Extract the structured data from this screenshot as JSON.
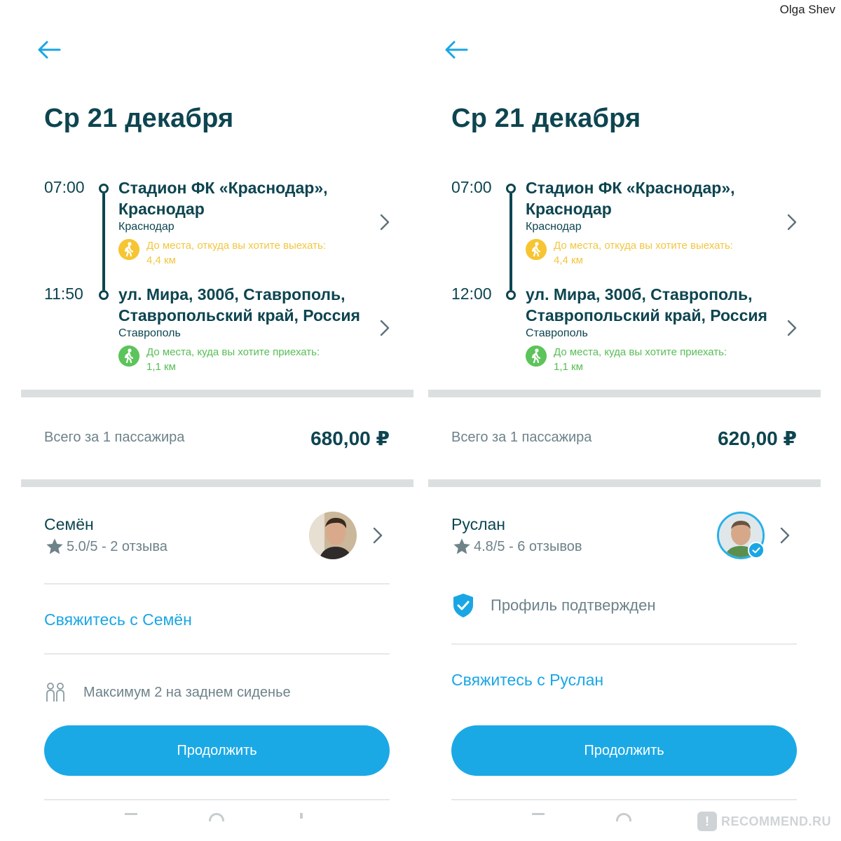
{
  "author": "Olga Shev",
  "watermark": "RECOMMEND.RU",
  "accent_color": "#1aa6e4",
  "dark_color": "#0d4550",
  "panels": [
    {
      "date": "Ср 21 декабря",
      "departure": {
        "time": "07:00",
        "title_line1": "Стадион ФК «Краснодар»,",
        "title_line2": "Краснодар",
        "city": "Краснодар",
        "walk_line1": "До места, откуда вы хотите выехать:",
        "walk_line2": "4,4 км"
      },
      "arrival": {
        "time": "11:50",
        "title_line1": "ул. Мира, 300б, Ставрополь,",
        "title_line2": "Ставропольский край, Россия",
        "city": "Ставрополь",
        "walk_line1": "До места, куда вы хотите приехать:",
        "walk_line2": "1,1 км"
      },
      "total_label": "Всего за 1 пассажира",
      "total_price": "680,00 ₽",
      "driver_name": "Семён",
      "rating": "5.0/5 - 2 отзыва",
      "contact": "Свяжитесь с Семён",
      "seats": "Максимум 2 на заднем сиденье",
      "continue": "Продолжить"
    },
    {
      "date": "Ср 21 декабря",
      "departure": {
        "time": "07:00",
        "title_line1": "Стадион ФК «Краснодар»,",
        "title_line2": "Краснодар",
        "city": "Краснодар",
        "walk_line1": "До места, откуда вы хотите выехать:",
        "walk_line2": "4,4 км"
      },
      "arrival": {
        "time": "12:00",
        "title_line1": "ул. Мира, 300б, Ставрополь,",
        "title_line2": "Ставропольский край, Россия",
        "city": "Ставрополь",
        "walk_line1": "До места, куда вы хотите приехать:",
        "walk_line2": "1,1 км"
      },
      "total_label": "Всего за 1 пассажира",
      "total_price": "620,00 ₽",
      "driver_name": "Руслан",
      "rating": "4.8/5 - 6 отзывов",
      "verified": "Профиль подтвержден",
      "contact": "Свяжитесь с Руслан",
      "continue": "Продолжить"
    }
  ]
}
